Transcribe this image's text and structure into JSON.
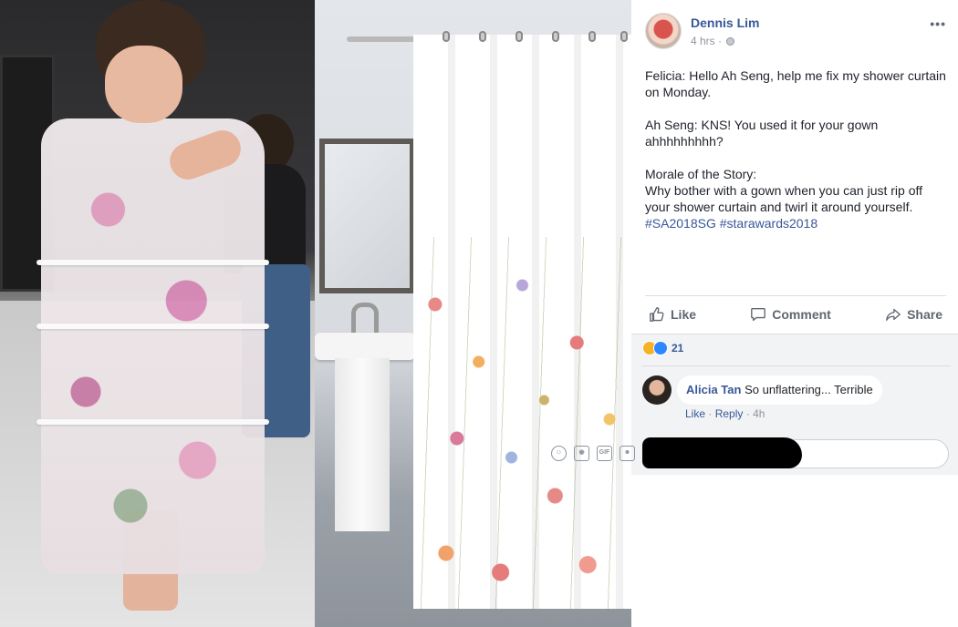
{
  "post": {
    "author": "Dennis Lim",
    "time": "4 hrs",
    "time_separator": "·",
    "more_label": "•••",
    "paragraphs": [
      "Felicia: Hello Ah Seng, help me fix my shower curtain on Monday.",
      "Ah Seng: KNS! You used it for your gown ahhhhhhhhh?",
      "Morale of the Story:"
    ],
    "last_paragraph": "Why bother with a gown when you can just rip off your shower curtain and twirl it around yourself.",
    "hashtags": [
      "#SA2018SG",
      "#starawards2018"
    ]
  },
  "actions": {
    "like": "Like",
    "comment": "Comment",
    "share": "Share"
  },
  "reactions": {
    "count": "21",
    "types": [
      "haha",
      "like"
    ]
  },
  "comment": {
    "name": "Alicia Tan",
    "text": "So unflattering... Terrible",
    "like_link": "Like",
    "reply_link": "Reply",
    "separator": "·",
    "time": "4h"
  },
  "composer": {
    "icons": [
      "emoji-icon",
      "camera-icon",
      "gif-icon",
      "sticker-icon"
    ],
    "gif_label": "GIF"
  },
  "colors": {
    "link_blue": "#385898",
    "meta_gray": "#90949c",
    "action_gray": "#606770",
    "panel_gray": "#f2f3f5"
  }
}
